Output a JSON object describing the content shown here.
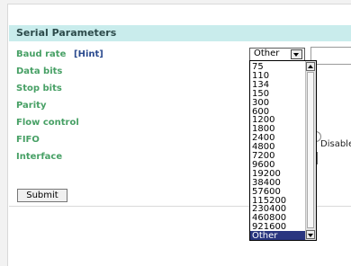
{
  "section": {
    "title": "Serial Parameters"
  },
  "fields": {
    "baud_rate": "Baud rate",
    "hint": "[Hint]",
    "data_bits": "Data bits",
    "stop_bits": "Stop bits",
    "parity": "Parity",
    "flow_control": "Flow control",
    "fifo": "FIFO",
    "interface": "Interface"
  },
  "baud_select": {
    "value": "Other"
  },
  "fifo_option": {
    "label": "Disable"
  },
  "baud_options": [
    "75",
    "110",
    "134",
    "150",
    "300",
    "600",
    "1200",
    "1800",
    "2400",
    "4800",
    "7200",
    "9600",
    "19200",
    "38400",
    "57600",
    "115200",
    "230400",
    "460800",
    "921600",
    "Other"
  ],
  "selected_option": "Other",
  "submit": {
    "label": "Submit"
  },
  "colors": {
    "header_bg": "#c9ecec",
    "label_green": "#47a065",
    "link_blue": "#2a4a8e",
    "highlight": "#2a3680"
  }
}
